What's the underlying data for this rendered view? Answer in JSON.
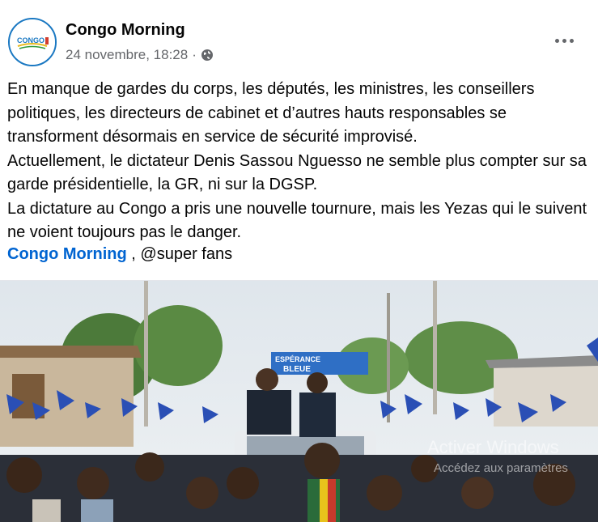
{
  "post": {
    "page_name": "Congo Morning",
    "timestamp": "24 novembre, 18:28",
    "separator": "·",
    "privacy_icon": "globe-icon",
    "avatar_text": "CONGO",
    "more_icon": "more-options-icon",
    "paragraphs": [
      "En manque de gardes du corps, les députés, les ministres, les conseillers politiques, les directeurs de cabinet et d’autres hauts responsables se transforment désormais en service de sécurité improvisé.",
      "Actuellement, le dictateur Denis Sassou Nguesso ne semble plus compter sur sa garde présidentielle, la GR, ni sur la DGSP.",
      "La dictature au Congo a pris une nouvelle tournure, mais les Yezas qui le suivent ne voient toujours pas le danger."
    ],
    "tag_link": "Congo Morning",
    "tag_suffix": " , @super fans"
  },
  "photo": {
    "banner_text_1": "ESPÉRANCE",
    "banner_text_2": "BLEUE"
  },
  "watermark": {
    "line1": "Activer Windows",
    "line2": "Accédez aux paramètres"
  },
  "colors": {
    "link": "#0064d1",
    "meta": "#65676b",
    "avatar_border": "#1a78c2",
    "flag_blue": "#2a4fb5"
  }
}
